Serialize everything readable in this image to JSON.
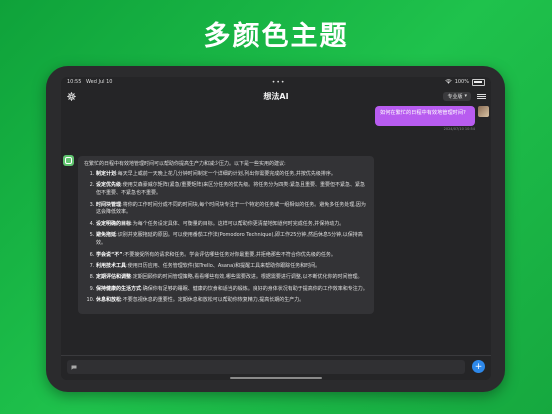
{
  "headline": "多颜色主题",
  "status": {
    "time": "10:55",
    "date": "Wed Jul 10",
    "dots": "•••",
    "battery": "100%"
  },
  "nav": {
    "title": "想法AI",
    "mode": "专业版",
    "mode_arrow": "▾"
  },
  "user_message": {
    "text": "如何在繁忙的日程中有效地管理时间?",
    "meta": "2024/07/10 10:54"
  },
  "answer": {
    "intro": "在繁忙的日程中有效地管理时间可以帮助你提高生产力和减少压力。以下是一些实用的建议:",
    "items": [
      {
        "title": "制定计划",
        "body": ":每天早上或前一天晚上花几分钟时间制定一个详细的计划,列出你需要完成的任务,并按优先级排序。"
      },
      {
        "title": "设定优先级",
        "body": ":使用艾森豪威尔矩阵(紧急/重要矩阵)来区分任务的优先级。将任务分为四类:紧急且重要、重要但不紧急、紧急但不重要、不紧急也不重要。"
      },
      {
        "title": "时间块管理",
        "body": ":将你的工作时间分成不同的时间块,每个时间块专注于一个特定的任务或一组相似的任务。避免多任务处理,因为这会降低效率。"
      },
      {
        "title": "设定明确的目标",
        "body": ":为每个任务设定具体、可衡量的目标。这样可以帮助你更清楚地知道何时完成任务,并保持动力。"
      },
      {
        "title": "避免拖延",
        "body": ":识别并克服拖延的原因。可以使用番茄工作法(Pomodoro Technique),即工作25分钟,然后休息5分钟,以保持高效。"
      },
      {
        "title": "学会说“不”",
        "body": ":不要接受所有的请求和任务。学会评估哪些任务对你最重要,并拒绝那些不符合你优先级的任务。"
      },
      {
        "title": "利用技术工具",
        "body": ":使用日历应用、任务管理软件(如Trello、Asana)和提醒工具来帮助你跟踪任务和时间。"
      },
      {
        "title": "定期评估和调整",
        "body": ":定期回顾你的时间管理策略,看看哪些有效,哪些需要改进。根据需要进行调整,以不断优化你的时间管理。"
      },
      {
        "title": "保持健康的生活方式",
        "body": ":确保你有足够的睡眠、健康的饮食和适当的锻炼。良好的身体状况有助于提高你的工作效率和专注力。"
      },
      {
        "title": "休息和放松",
        "body": ":不要忽视休息的重要性。定期休息和放松可以帮助你恢复精力,提高长期的生产力。"
      }
    ]
  },
  "input": {
    "placeholder": ""
  },
  "icons": {
    "settings": "gear-icon",
    "menu": "menu-icon",
    "send": "send-icon",
    "wifi": "wifi-icon",
    "battery": "battery-icon",
    "bot": "bot-avatar-icon"
  },
  "colors": {
    "background": "#16a83f",
    "user_bubble": "#b85cf0",
    "send_button": "#2d88ea",
    "bot_avatar": "#5fc36e",
    "screen": "#252527",
    "answer_bubble": "#333336"
  }
}
